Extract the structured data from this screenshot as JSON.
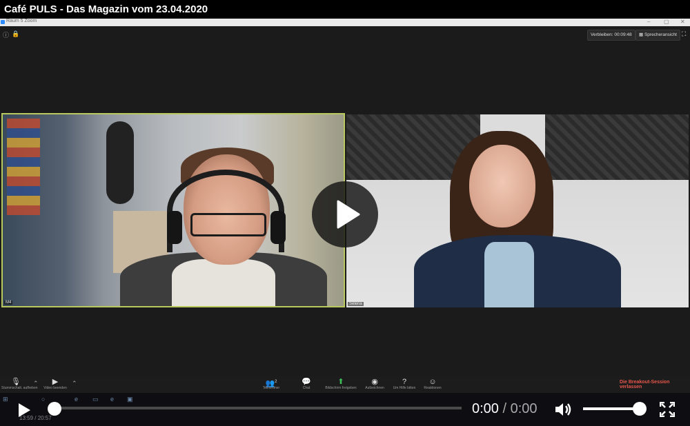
{
  "page": {
    "title": "Café PULS - Das Magazin vom 23.04.2020"
  },
  "zoom_window": {
    "title": "Raum 5  Zoom",
    "remaining": "Verbleiben: 00:09:48",
    "speaker_view": "Sprecheransicht",
    "participants": [
      {
        "label": "M4"
      },
      {
        "label": "Selena"
      }
    ],
    "toolbar": {
      "mute": "Stummschalt. aufheben",
      "video": "Video beenden",
      "participants": "Teilnehmer",
      "participants_count": "2",
      "chat": "Chat",
      "share": "Bildschirm freigeben",
      "record": "Aufzeichnen",
      "help": "Um Hilfe bitten",
      "reactions": "Reaktionen",
      "leave_breakout": "Die Breakout-Session verlassen"
    }
  },
  "underlying_player": {
    "time": "13:59 / 20:57"
  },
  "player": {
    "current_time": "0:00",
    "separator": "/",
    "duration": "0:00",
    "progress_fraction": 0.0,
    "volume_fraction": 0.9,
    "icons": [
      "play-icon",
      "volume-icon",
      "fullscreen-icon",
      "big-play-icon"
    ]
  }
}
